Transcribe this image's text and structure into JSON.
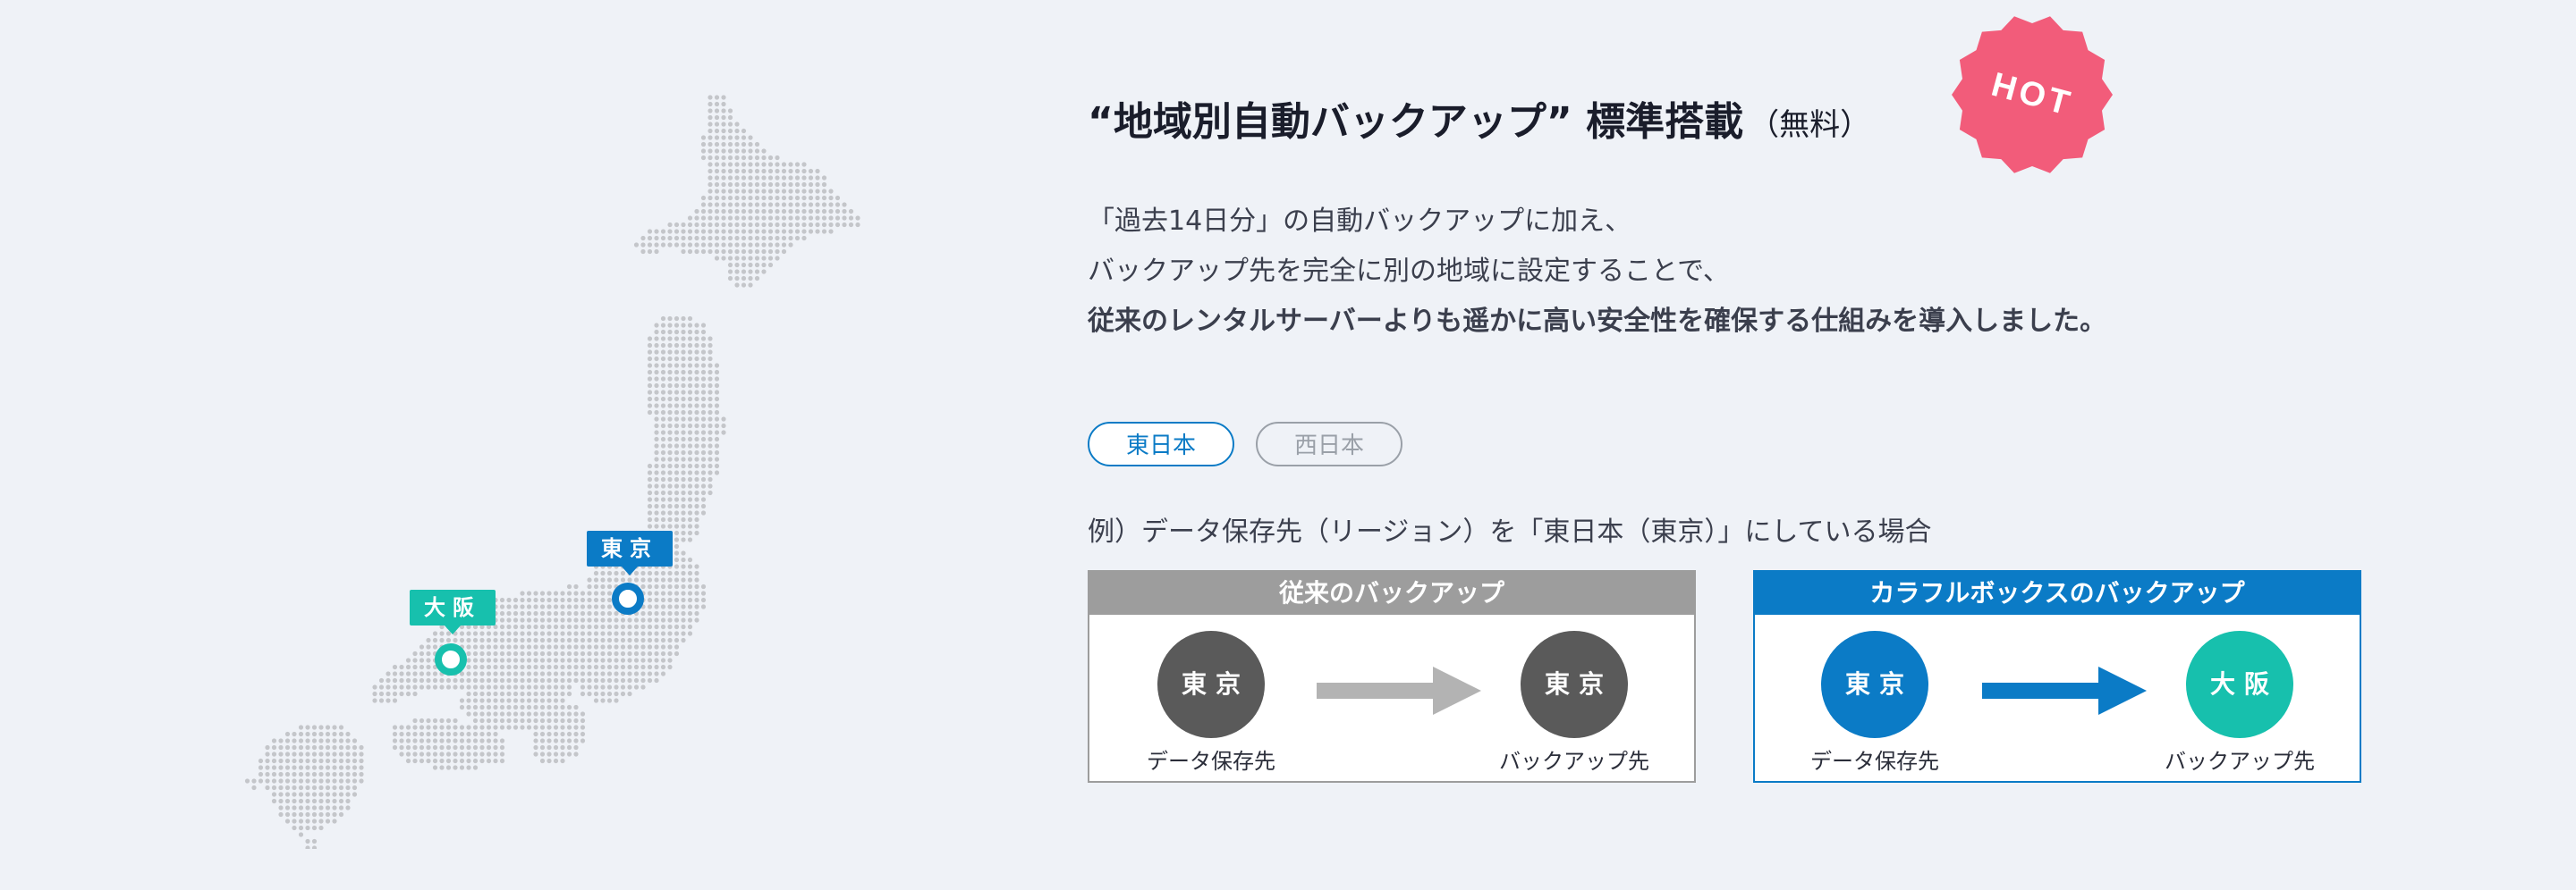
{
  "map": {
    "tokyo_label": "東京",
    "osaka_label": "大阪"
  },
  "title": {
    "main": "“地域別自動バックアップ” 標準搭載",
    "sub": "（無料）"
  },
  "badge": {
    "text": "HOT",
    "color": "#f25c7a"
  },
  "description": {
    "line1": "「過去14日分」の自動バックアップに加え、",
    "line2": "バックアップ先を完全に別の地域に設定することで、",
    "line3": "従来のレンタルサーバーよりも遥かに高い安全性を確保する仕組みを導入しました。"
  },
  "tabs": {
    "east": "東日本",
    "west": "西日本"
  },
  "example": "例）データ保存先（リージョン）を「東日本（東京）」にしている場合",
  "conventional": {
    "header": "従来のバックアップ",
    "source_circle": "東京",
    "dest_circle": "東京",
    "source_caption": "データ保存先",
    "dest_caption": "バックアップ先"
  },
  "colorful": {
    "header": "カラフルボックスのバックアップ",
    "source_circle": "東京",
    "dest_circle": "大阪",
    "source_caption": "データ保存先",
    "dest_caption": "バックアップ先"
  },
  "colors": {
    "background": "#eff2f7",
    "accent_blue": "#0b7bc6",
    "accent_teal": "#17c0ad",
    "gray": "#9d9d9d",
    "map_dot": "#c4c6ca"
  }
}
